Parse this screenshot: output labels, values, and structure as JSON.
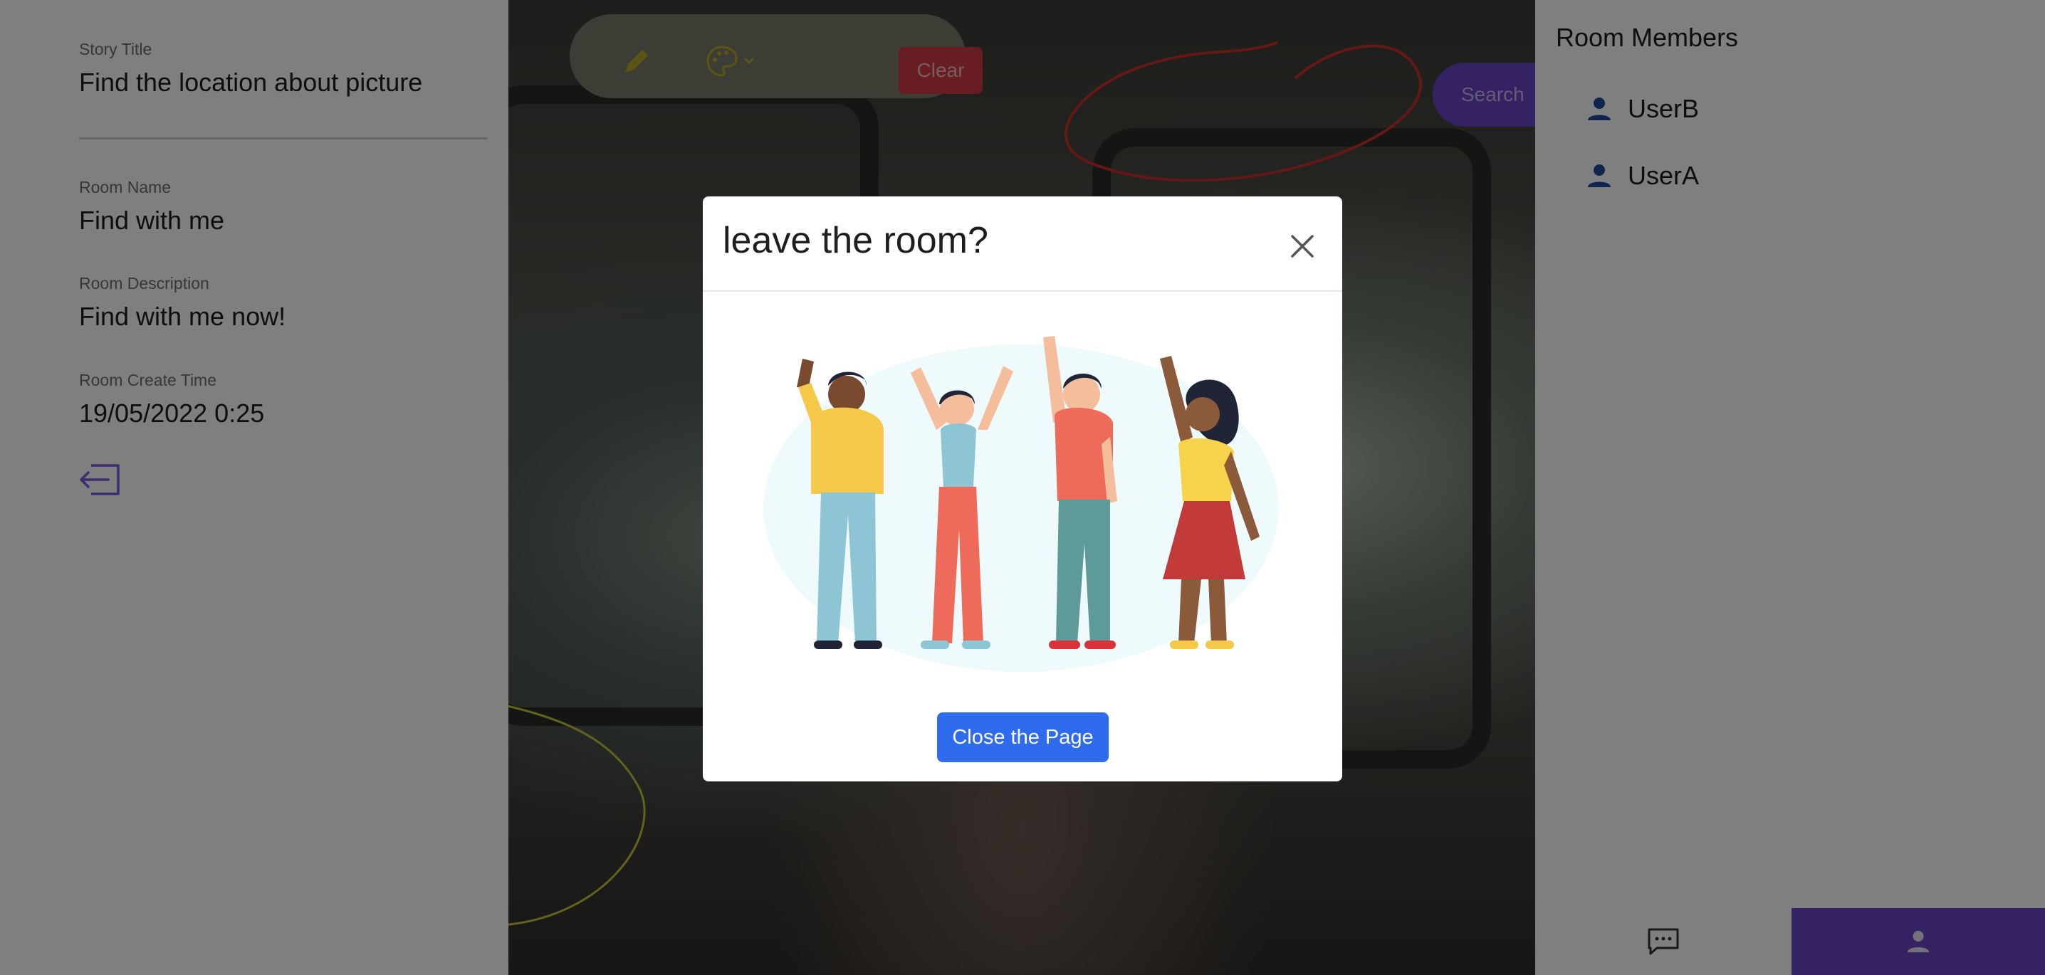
{
  "left_panel": {
    "story_title_label": "Story Title",
    "story_title": "Find the location about picture",
    "room_name_label": "Room Name",
    "room_name": "Find with me",
    "room_description_label": "Room Description",
    "room_description": "Find with me now!",
    "room_create_time_label": "Room Create Time",
    "room_create_time": "19/05/2022 0:25",
    "exit_icon": "exit-icon"
  },
  "toolbar": {
    "pencil_icon": "pencil-icon",
    "palette_icon": "palette-icon",
    "clear_label": "Clear",
    "search_label": "Search"
  },
  "members": {
    "title": "Room Members",
    "items": [
      {
        "name": "UserB",
        "icon": "user-icon"
      },
      {
        "name": "UserA",
        "icon": "user-icon"
      }
    ]
  },
  "bottom_nav": {
    "chat_icon": "chat-icon",
    "members_icon": "user-icon"
  },
  "modal": {
    "title": "leave the room?",
    "close_icon": "close-icon",
    "button_label": "Close the Page"
  },
  "colors": {
    "accent_purple": "#6a45c4",
    "primary_blue": "#2f6bed",
    "danger_red": "#d13a47",
    "member_icon_blue": "#1f4a9e"
  }
}
